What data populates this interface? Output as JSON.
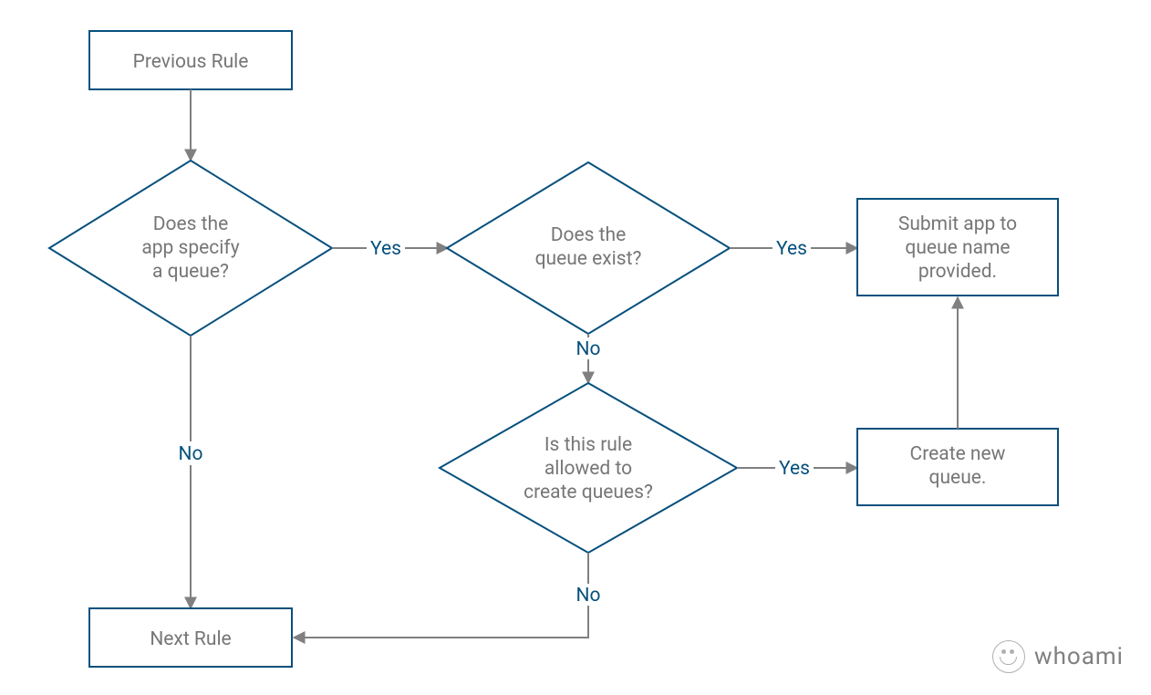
{
  "nodes": {
    "previous_rule": "Previous Rule",
    "next_rule": "Next Rule",
    "app_specify_l1": "Does the",
    "app_specify_l2": "app specify",
    "app_specify_l3": "a queue?",
    "queue_exist_l1": "Does the",
    "queue_exist_l2": "queue exist?",
    "rule_allowed_l1": "Is this rule",
    "rule_allowed_l2": "allowed to",
    "rule_allowed_l3": "create queues?",
    "submit_l1": "Submit app to",
    "submit_l2": "queue name",
    "submit_l3": "provided.",
    "create_l1": "Create new",
    "create_l2": "queue."
  },
  "edges": {
    "yes1": "Yes",
    "no1": "No",
    "yes2": "Yes",
    "no2": "No",
    "yes3": "Yes",
    "no3": "No"
  },
  "watermark": "whoami",
  "colors": {
    "shape_stroke": "#06507d",
    "arrow_stroke": "#808080",
    "text_node": "#767676",
    "text_edge": "#06507d"
  }
}
